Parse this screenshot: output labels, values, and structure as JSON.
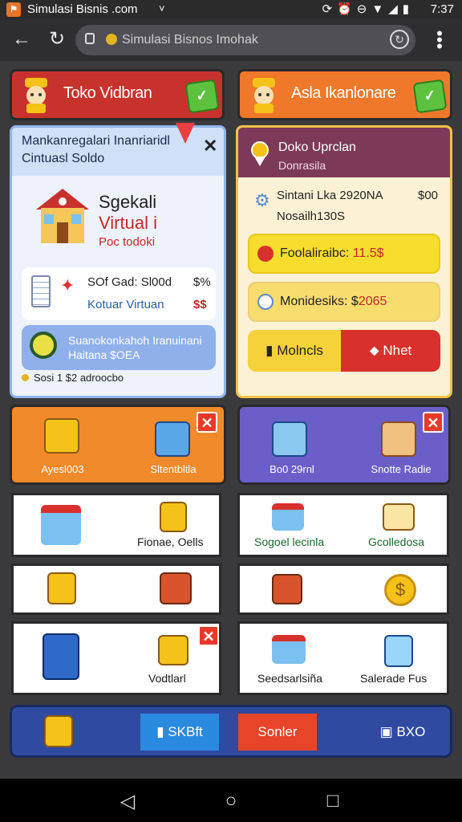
{
  "status_bar": {
    "app_title": "Simulasi Bisnis .com",
    "dropdown_arrow": "˅",
    "clock": "7:37",
    "icons": [
      "sync-icon",
      "alarm-icon",
      "dnd-icon",
      "wifi-icon",
      "signal-icon",
      "battery-icon"
    ]
  },
  "browser": {
    "url": "Simulasi Bisnos Imohak"
  },
  "banners": {
    "left_label": "Toko Vidbran",
    "right_label": "Asla Ikanlonare"
  },
  "left_panel": {
    "header_line1": "Mankanregalari Inanriaridl",
    "header_line2": "Cintuasl Soldo",
    "brand_line1": "Sgekali",
    "brand_line2": "Virtual i",
    "brand_line3": "Poc todoki",
    "stat_row1_label": "SOf Gad: Sl00d",
    "stat_row1_value": "$%",
    "stat_row2_label": "Kotuar Virtuan",
    "stat_row2_value": "$$",
    "search_text_line1": "Suanokonkahoh Iranuinani",
    "search_text_line2": "Haitana $OEA",
    "footer_text": "Sosi 1 $2 adroocbo"
  },
  "right_panel": {
    "header_title": "Doko Uprclan",
    "header_subtitle": "Donrasila",
    "line1": "Sintani Lka 2920NA",
    "line2": "Nosailh130S",
    "amount": "$00",
    "row_a_label": "Foolaliraibc:",
    "row_a_value": "11.5$",
    "row_b_label": "Monidesiks: $",
    "row_b_value": "2065",
    "btn_left": "Molncls",
    "btn_right": "Nhet"
  },
  "tiles": {
    "orange_left_label": "Ayesl003",
    "orange_right_label": "Sltentbltla",
    "purple_left_label": "Bo0 29rnl",
    "purple_right_label": "Snotte Radie"
  },
  "cards": {
    "row1_left_label": "Fionae, Oells",
    "row1_right_left_label": "Sogoel lecinla",
    "row1_right_right_label": "Gcolledosa",
    "row3_left_label": "Vodtlarl",
    "row3_right_left_label": "Seedsarlsiña",
    "row3_right_right_label": "Salerade Fus"
  },
  "bottom_bar": {
    "btn1": "SKBft",
    "btn2": "Sonler",
    "btn3": "BXO"
  },
  "colors": {
    "banner_left": "#c8322c",
    "banner_right": "#f0782a",
    "accent_red": "#d8302c",
    "accent_yellow": "#f5d23a",
    "purple": "#6a5fc8",
    "orange": "#f08a2a",
    "navy": "#2f4aa0"
  }
}
